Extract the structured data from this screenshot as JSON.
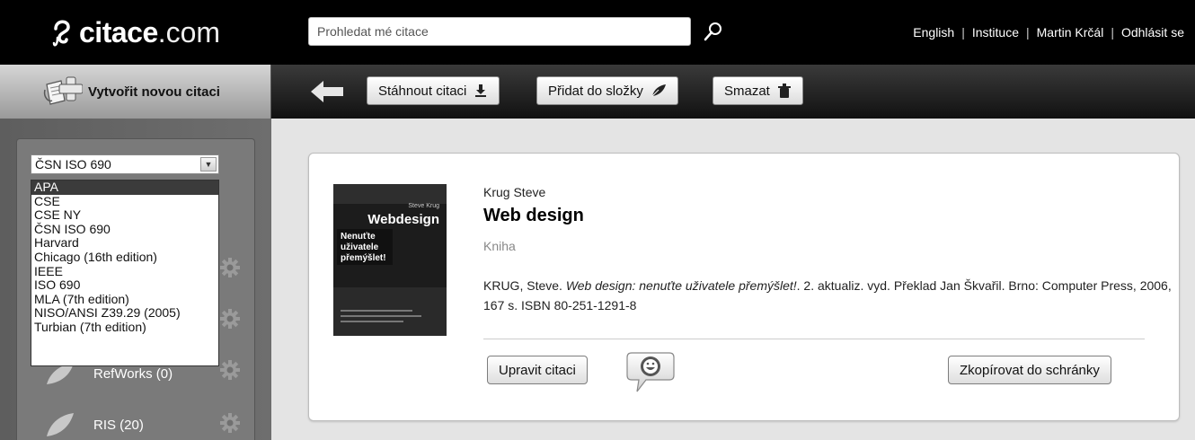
{
  "header": {
    "logo_brand": "citace",
    "logo_tld": ".com",
    "search_placeholder": "Prohledat mé citace",
    "links": [
      "English",
      "Instituce",
      "Martin Krčál",
      "Odhlásit se"
    ]
  },
  "sidebar": {
    "create_label": "Vytvořit novou citaci",
    "style_selected": "ČSN ISO 690",
    "style_options": [
      "APA",
      "CSE",
      "CSE NY",
      "ČSN ISO 690",
      "Harvard",
      "Chicago (16th edition)",
      "IEEE",
      "ISO 690",
      "MLA (7th edition)",
      "NISO/ANSI Z39.29 (2005)",
      "Turbian (7th edition)"
    ],
    "highlighted_option": "APA",
    "folders": [
      {
        "label": "RefWorks (0)"
      },
      {
        "label": "RIS (20)"
      }
    ]
  },
  "toolbar": {
    "download_label": "Stáhnout citaci",
    "add_folder_label": "Přidat do složky",
    "delete_label": "Smazat"
  },
  "record": {
    "author": "Krug Steve",
    "title": "Web design",
    "type": "Kniha",
    "citation_prefix": "KRUG, Steve. ",
    "citation_title": "Web design: nenuťte uživatele přemýšlet!",
    "citation_rest": ". 2. aktualiz. vyd. Překlad Jan Škvařil. Brno: Computer Press, 2006, 167 s. ISBN 80-251-1291-8",
    "cover": {
      "author_line": "Steve Krug",
      "title_line": "Webdesign",
      "subtitle_lines": [
        "Nenuťte",
        "uživatele",
        "přemýšlet!"
      ]
    },
    "edit_label": "Upravit citaci",
    "copy_label": "Zkopírovat do schránky"
  },
  "colors": {
    "topbar": "#000000",
    "panel": "#666666",
    "card": "#ffffff"
  }
}
